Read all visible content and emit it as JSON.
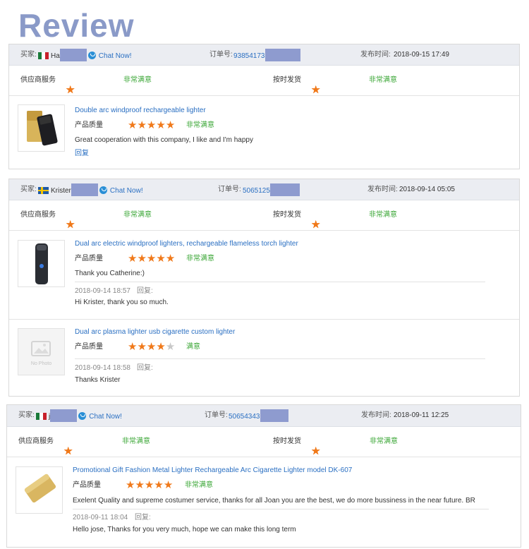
{
  "title": "Review",
  "labels": {
    "buyer": "买家:",
    "order": "订单号:",
    "posted": "发布时间:",
    "supplier_service": "供应商服务",
    "on_time": "按时发货",
    "product_quality": "产品质量",
    "reply": "回复:",
    "reply_link": "回复",
    "chat_now": "Chat Now!",
    "no_photo": "No Photo"
  },
  "reviews": [
    {
      "buyer_name": "Ha",
      "country_flag": "Mexico",
      "order_prefix": "93854173",
      "posted_time": "2018-09-15 17:49",
      "supplier_rating": 5,
      "supplier_text": "非常满意",
      "shipping_rating": 5,
      "shipping_text": "非常满意",
      "items": [
        {
          "product": "Double arc windproof rechargeable lighter",
          "quality_rating": 5,
          "quality_text": "非常满意",
          "comment": "Great cooperation with this company, I like and I'm happy"
        }
      ]
    },
    {
      "buyer_name": "Krister",
      "country_flag": "Sweden",
      "order_prefix": "5065125",
      "posted_time": "2018-09-14 05:05",
      "supplier_rating": 5,
      "supplier_text": "非常满意",
      "shipping_rating": 5,
      "shipping_text": "非常满意",
      "items": [
        {
          "product": "Dual arc electric windproof lighters, rechargeable flameless torch lighter",
          "quality_rating": 5,
          "quality_text": "非常满意",
          "comment": "Thank you Catherine:)",
          "reply_date": "2018-09-14 18:57",
          "reply_text": "Hi Krister, thank you so much."
        },
        {
          "product": "Dual arc plasma lighter usb cigarette custom lighter",
          "quality_rating": 4,
          "quality_text": "满意",
          "reply_date": "2018-09-14 18:58",
          "reply_text": "Thanks Krister"
        }
      ]
    },
    {
      "buyer_name": "j",
      "country_flag": "Mexico",
      "order_prefix": "50654343",
      "posted_time": "2018-09-11 12:25",
      "supplier_rating": 5,
      "supplier_text": "非常满意",
      "shipping_rating": 5,
      "shipping_text": "非常满意",
      "items": [
        {
          "product": "Promotional Gift Fashion Metal Lighter Rechargeable Arc Cigarette Lighter model DK-607",
          "quality_rating": 5,
          "quality_text": "非常满意",
          "comment": "Exelent Quality and supreme costumer service, thanks for all Joan you are the best, we do more bussiness in the near future. BR",
          "reply_date": "2018-09-11 18:04",
          "reply_text": "Hello jose, Thanks for you very much, hope we can make this long term"
        }
      ]
    }
  ]
}
